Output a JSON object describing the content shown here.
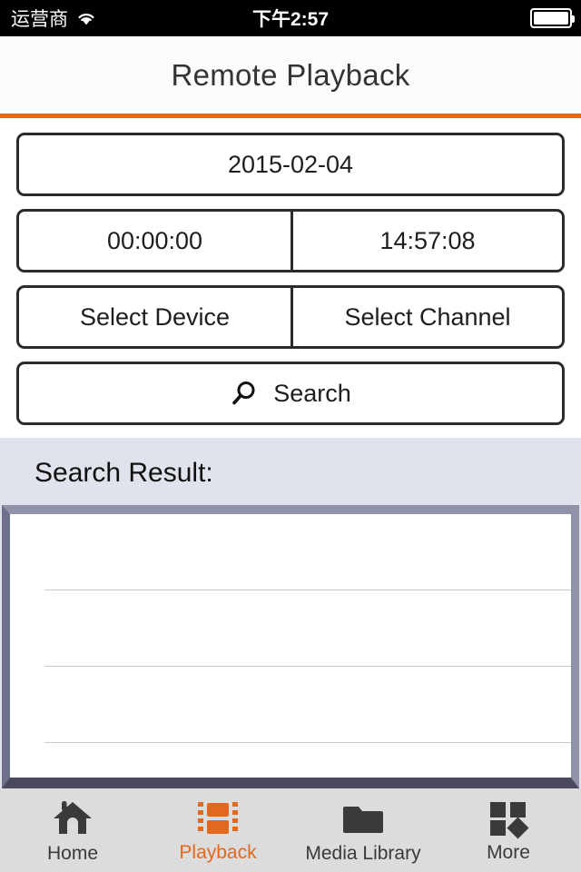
{
  "statusbar": {
    "carrier": "运营商",
    "time": "下午2:57",
    "wifi_icon": "wifi-icon",
    "battery_icon": "battery-icon"
  },
  "navbar": {
    "title": "Remote Playback",
    "accent_color": "#e0691f"
  },
  "form": {
    "date": "2015-02-04",
    "start_time": "00:00:00",
    "end_time": "14:57:08",
    "select_device": "Select Device",
    "select_channel": "Select Channel",
    "search_label": "Search",
    "search_icon": "magnifier-icon"
  },
  "results": {
    "title": "Search Result:",
    "rows": [
      "",
      "",
      "",
      ""
    ],
    "background_color": "#e0e3ec"
  },
  "tabbar": {
    "items": [
      {
        "label": "Home",
        "icon": "home-icon",
        "active": false
      },
      {
        "label": "Playback",
        "icon": "film-strip-icon",
        "active": true
      },
      {
        "label": "Media Library",
        "icon": "folder-icon",
        "active": false
      },
      {
        "label": "More",
        "icon": "grid-more-icon",
        "active": false
      }
    ],
    "active_color": "#e0691f",
    "inactive_color": "#3a3a3a"
  }
}
